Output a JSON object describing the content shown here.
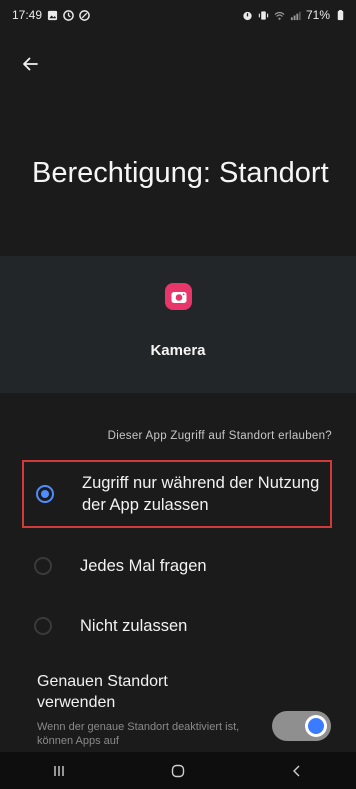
{
  "status_bar": {
    "time": "17:49",
    "battery": "71%"
  },
  "header": {
    "title": "Berechtigung: Standort"
  },
  "app": {
    "name": "Kamera",
    "icon": "camera-icon",
    "icon_color": "#e8356a"
  },
  "permission": {
    "question": "Dieser App Zugriff auf Standort erlauben?",
    "options": [
      {
        "label": "Zugriff nur während der Nutzung der App zulassen",
        "selected": true
      },
      {
        "label": "Jedes Mal fragen",
        "selected": false
      },
      {
        "label": "Nicht zulassen",
        "selected": false
      }
    ]
  },
  "precise_location": {
    "title": "Genauen Standort verwenden",
    "description": "Wenn der genaue Standort deaktiviert ist, können Apps auf",
    "enabled": true
  },
  "colors": {
    "accent": "#4f8cff",
    "highlight_border": "#d23a3a",
    "background": "#1b1b1b"
  },
  "nav_bar": {
    "icons": [
      "recents-icon",
      "home-icon",
      "back-icon"
    ]
  }
}
